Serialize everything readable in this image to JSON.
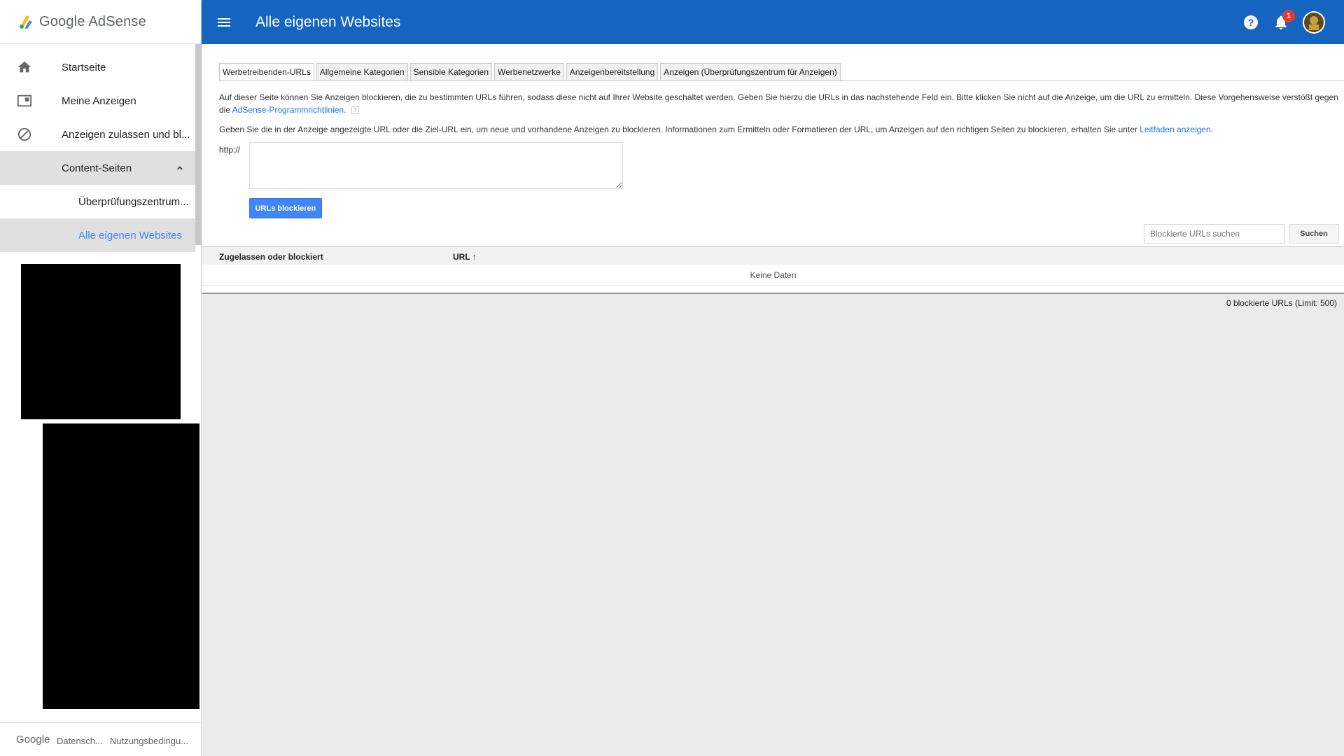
{
  "brand": {
    "name": "Google AdSense"
  },
  "header": {
    "title": "Alle eigenen Websites",
    "notification_count": "1"
  },
  "sidebar": {
    "items": [
      {
        "label": "Startseite",
        "icon": "home-icon"
      },
      {
        "label": "Meine Anzeigen",
        "icon": "ad-icon"
      },
      {
        "label": "Anzeigen zulassen und bl...",
        "icon": "block-icon"
      },
      {
        "label": "Content-Seiten",
        "icon": "chevron-up-icon"
      },
      {
        "label": "Überprüfungszentrum..."
      },
      {
        "label": "Alle eigenen Websites"
      }
    ],
    "footer": {
      "google": "Google",
      "privacy": "Datensch...",
      "terms": "Nutzungsbedingu..."
    }
  },
  "tabs": [
    "Werbetreibenden-URLs",
    "Allgemeine Kategorien",
    "Sensible Kategorien",
    "Werbenetzwerke",
    "Anzeigenbereitstellung",
    "Anzeigen (Überprüfungszentrum für Anzeigen)"
  ],
  "content": {
    "intro_text": "Auf dieser Seite können Sie Anzeigen blockieren, die zu bestimmten URLs führen, sodass diese nicht auf Ihrer Website geschaltet werden. Geben Sie hierzu die URLs in das nachstehende Feld ein. Bitte klicken Sie nicht auf die Anzeige, um die URL zu ermitteln. Diese Vorgehensweise verstößt gegen die",
    "intro_link": "AdSense-Programmrichtlinien",
    "intro_end": ".",
    "help_mark": "?",
    "instructions_text": "Geben Sie die in der Anzeige angezeigte URL oder die Ziel-URL ein, um neue und vorhandene Anzeigen zu blockieren. Informationen zum Ermitteln oder Formatieren der URL, um Anzeigen auf den richtigen Seiten zu blockieren, erhalten Sie unter",
    "instructions_link": "Leitfaden anzeigen",
    "instructions_end": ".",
    "http_prefix": "http://",
    "block_button": "URLs blockieren",
    "search_placeholder": "Blockierte URLs suchen",
    "search_button": "Suchen"
  },
  "table": {
    "col_status": "Zugelassen oder blockiert",
    "col_url": "URL ↑",
    "empty": "Keine Daten",
    "count": "0 blockierte URLs (Limit: 500)"
  },
  "colors": {
    "header": "#1565c0",
    "accent": "#4285f4",
    "badge": "#e53935"
  }
}
